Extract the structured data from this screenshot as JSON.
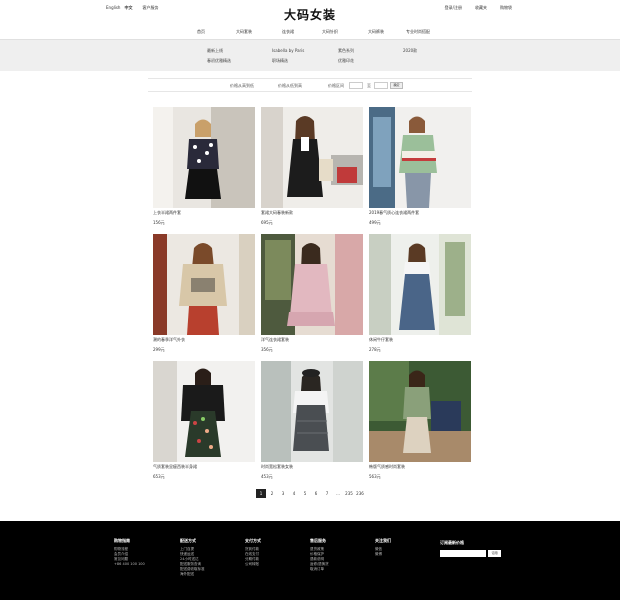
{
  "topbar": {
    "lang_en": "English",
    "lang_zh": "中文",
    "customer_service": "客户服务",
    "logo": "大码女装",
    "login": "登录/注册",
    "wishlist": "收藏夹",
    "cart": "购物袋"
  },
  "nav": [
    "首页",
    "大码套装",
    "连衣裙",
    "大码针织",
    "大码裤装",
    "专业时尚搭配"
  ],
  "mega": [
    "最新上线",
    "Isabella by Paris",
    "素色系列",
    "2020款",
    "春初优雅精选",
    "职场精选",
    "优雅印花"
  ],
  "filter": {
    "sort_label": "价格从高到低",
    "sort2_label": "价格从低到高",
    "price_label": "价格区间",
    "to": "至",
    "go": "确定"
  },
  "products": [
    {
      "name": "上衣半裙两件套",
      "price": "156元"
    },
    {
      "name": "套裙大码春装新款",
      "price": "695元"
    },
    {
      "name": "2019春气质心连衣裙两件套",
      "price": "499元"
    },
    {
      "name": "潮的春季洋气外衣",
      "price": "299元"
    },
    {
      "name": "洋气连衣裙套装",
      "price": "356元"
    },
    {
      "name": "休闲牛仔套装",
      "price": "278元"
    },
    {
      "name": "气质套装显瘦西装半身裙",
      "price": "653元"
    },
    {
      "name": "时尚宽松套装女装",
      "price": "453元"
    },
    {
      "name": "韩版气质感时尚套装",
      "price": "563元"
    }
  ],
  "pager": [
    "1",
    "2",
    "3",
    "4",
    "5",
    "6",
    "7",
    "...",
    "235",
    "236"
  ],
  "footer": {
    "cols": [
      {
        "title": "购物指南",
        "links": [
          "购物流程",
          "会员介绍",
          "常见问题",
          "+86 400 100 100"
        ]
      },
      {
        "title": "配送方式",
        "links": [
          "上门自提",
          "快递运送",
          "24小时送达",
          "配送服务查询",
          "配送费收取标准",
          "海外配送"
        ]
      },
      {
        "title": "支付方式",
        "links": [
          "货到付款",
          "在线支付",
          "分期付款",
          "公司转账"
        ]
      },
      {
        "title": "售后服务",
        "links": [
          "退货政策",
          "价格保护",
          "退款说明",
          "返修/退换货",
          "取消订单"
        ]
      },
      {
        "title": "关注我们",
        "links": [
          "微信",
          "微博"
        ]
      }
    ],
    "subscribe_title": "订阅最新价格",
    "subscribe_btn": "订阅"
  }
}
